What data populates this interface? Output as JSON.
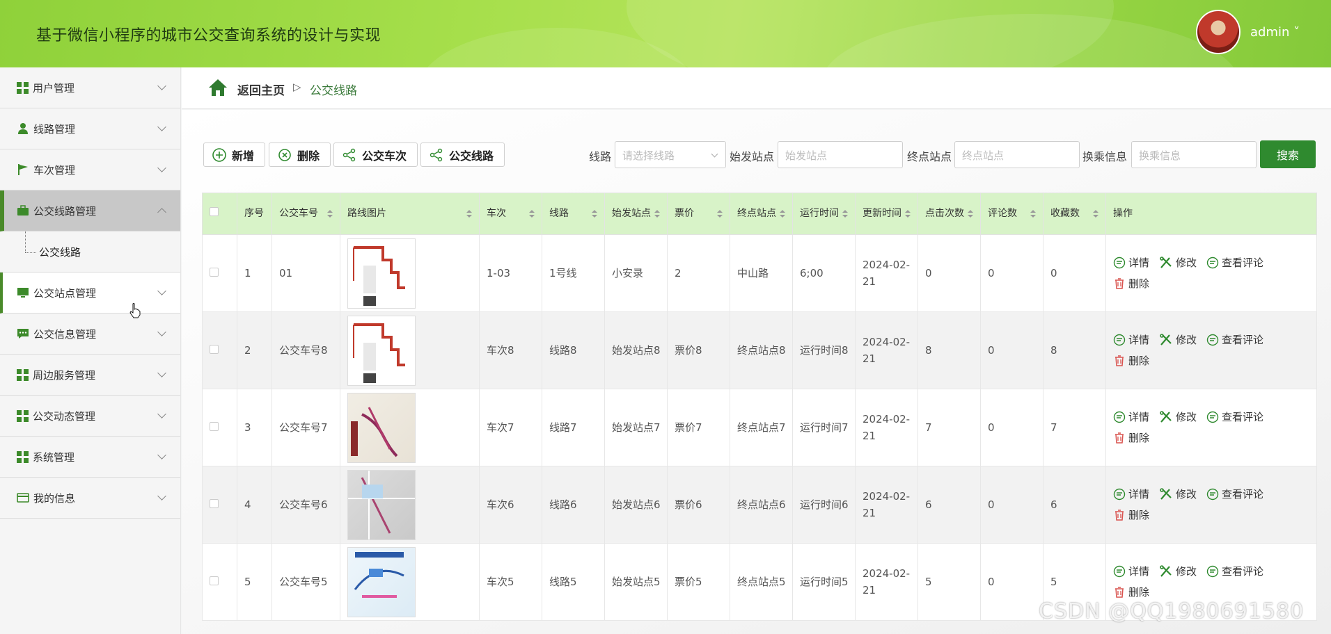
{
  "header": {
    "title": "基于微信小程序的城市公交查询系统的设计与实现",
    "user": "admin ˅"
  },
  "sidebar": {
    "items": [
      {
        "label": "用户管理",
        "icon": "grid-icon"
      },
      {
        "label": "线路管理",
        "icon": "person-icon"
      },
      {
        "label": "车次管理",
        "icon": "flag-icon"
      },
      {
        "label": "公交线路管理",
        "icon": "briefcase-icon",
        "open": true,
        "children": [
          "公交线路"
        ]
      },
      {
        "label": "公交站点管理",
        "icon": "monitor-icon"
      },
      {
        "label": "公交信息管理",
        "icon": "chat-icon"
      },
      {
        "label": "周边服务管理",
        "icon": "grid-icon"
      },
      {
        "label": "公交动态管理",
        "icon": "grid-icon"
      },
      {
        "label": "系统管理",
        "icon": "grid-icon"
      },
      {
        "label": "我的信息",
        "icon": "card-icon"
      }
    ]
  },
  "breadcrumb": {
    "home": "返回主页",
    "separator": "▷",
    "current": "公交线路"
  },
  "toolbar": {
    "add": "新增",
    "delete": "删除",
    "bus_trips": "公交车次",
    "bus_lines": "公交线路"
  },
  "filters": {
    "line_label": "线路",
    "line_placeholder": "请选择线路",
    "start_label": "始发站点",
    "start_placeholder": "始发站点",
    "end_label": "终点站点",
    "end_placeholder": "终点站点",
    "transfer_label": "换乘信息",
    "transfer_placeholder": "换乘信息",
    "search": "搜索"
  },
  "table": {
    "headers": [
      "序号",
      "公交车号",
      "路线图片",
      "车次",
      "线路",
      "始发站点",
      "票价",
      "终点站点",
      "运行时间",
      "更新时间",
      "点击次数",
      "评论数",
      "收藏数",
      "操作"
    ],
    "rows": [
      {
        "no": "1",
        "bus": "01",
        "trip": "1-03",
        "line": "1号线",
        "start": "小安录",
        "price": "2",
        "end": "中山路",
        "time": "6;00",
        "updated": "2024-02-21",
        "clicks": "0",
        "comments": "0",
        "favs": "0"
      },
      {
        "no": "2",
        "bus": "公交车号8",
        "trip": "车次8",
        "line": "线路8",
        "start": "始发站点8",
        "price": "票价8",
        "end": "终点站点8",
        "time": "运行时间8",
        "updated": "2024-02-21",
        "clicks": "8",
        "comments": "0",
        "favs": "8"
      },
      {
        "no": "3",
        "bus": "公交车号7",
        "trip": "车次7",
        "line": "线路7",
        "start": "始发站点7",
        "price": "票价7",
        "end": "终点站点7",
        "time": "运行时间7",
        "updated": "2024-02-21",
        "clicks": "7",
        "comments": "0",
        "favs": "7"
      },
      {
        "no": "4",
        "bus": "公交车号6",
        "trip": "车次6",
        "line": "线路6",
        "start": "始发站点6",
        "price": "票价6",
        "end": "终点站点6",
        "time": "运行时间6",
        "updated": "2024-02-21",
        "clicks": "6",
        "comments": "0",
        "favs": "6"
      },
      {
        "no": "5",
        "bus": "公交车号5",
        "trip": "车次5",
        "line": "线路5",
        "start": "始发站点5",
        "price": "票价5",
        "end": "终点站点5",
        "time": "运行时间5",
        "updated": "2024-02-21",
        "clicks": "5",
        "comments": "0",
        "favs": "5"
      }
    ],
    "actions": {
      "detail": "详情",
      "edit": "修改",
      "comments": "查看评论",
      "delete": "删除"
    }
  },
  "watermark": "CSDN @QQ1980691580",
  "colors": {
    "accent": "#2f8a2f",
    "header_green": "#a6df4b",
    "table_header": "#d8f3c8"
  }
}
